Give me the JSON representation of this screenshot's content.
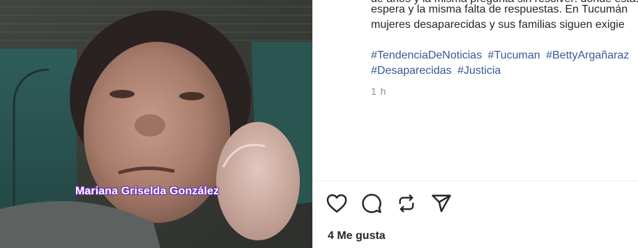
{
  "video": {
    "caption_name": "Mariana Griselda González"
  },
  "post": {
    "line_partial_top": "de años y la misma pregunta sin resolver: dónde está. La familia mantiene",
    "line_1": "espera y la misma falta de respuestas. En Tucumán",
    "line_2": "mujeres desaparecidas y sus familias siguen exigie",
    "hashtags_row1": [
      "#TendenciaDeNoticias",
      "#Tucuman",
      "#BettyArgañaraz"
    ],
    "hashtags_row2": [
      "#Desaparecidas",
      "#Justicia"
    ],
    "time": "1 h"
  },
  "actions": {
    "like": "heart-icon",
    "comment": "comment-icon",
    "repost": "repost-icon",
    "share": "send-icon"
  },
  "likes_label": "4 Me gusta",
  "colors": {
    "hashtag": "#385898",
    "caption_outline": "#6b2fb3",
    "time": "#8e8e8e"
  }
}
